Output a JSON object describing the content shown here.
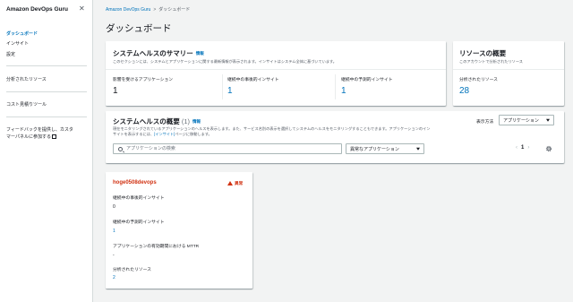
{
  "sidebar": {
    "title": "Amazon DevOps Guru",
    "close_glyph": "✕",
    "items": [
      {
        "label": "ダッシュボード",
        "active": true
      },
      {
        "label": "インサイト"
      },
      {
        "label": "設定"
      },
      {
        "label": "分析されたリソース"
      },
      {
        "label": "コスト見積りツール"
      }
    ],
    "feedback_line1": "フィードバックを提供し、カスタ",
    "feedback_line2": "マーパネルに参加する"
  },
  "breadcrumb": {
    "root": "Amazon DevOps Guru",
    "separator": ">",
    "current": "ダッシュボード"
  },
  "page": {
    "title": "ダッシュボード"
  },
  "system_health_summary": {
    "title": "システムヘルスのサマリー",
    "info": "情報",
    "description": "このセクションには、システムとアプリケーションに関する最新情報が表示されます。インサイトはシステム全体に基づいています。",
    "metrics": [
      {
        "label": "影響を受けるアプリケーション",
        "value": "1",
        "link": false
      },
      {
        "label": "継続中の事後的インサイト",
        "value": "1",
        "link": true
      },
      {
        "label": "継続中の予測的インサイト",
        "value": "1",
        "link": true
      }
    ]
  },
  "resource_overview": {
    "title": "リソースの概要",
    "description": "このアカウントで分析されたリソース",
    "label": "分析されたリソース",
    "value": "28"
  },
  "system_health_overview": {
    "title": "システムヘルスの概要",
    "count": "(1)",
    "info": "情報",
    "desc_line1": "現在モニタリングされているアプリケーションのヘルスを表示します。また、サービス名別の表示を選択してシステムのヘルスをモニタリングすることもできます。アプリケーションのイン",
    "desc_line2_a": "サイトを表示するには、",
    "desc_line2_link": "[インサイト]",
    "desc_line2_b": "ページに移動します。",
    "display_label": "表示方法",
    "display_select": "アプリケーション",
    "search_placeholder": "アプリケーションの検索",
    "filter_select": "異常なアプリケーション",
    "pager": {
      "prev": "‹",
      "page": "1",
      "next": "›"
    }
  },
  "app_card": {
    "name": "hoge0508devops",
    "status": "異常",
    "fields": [
      {
        "label": "継続中の事後的インサイト",
        "value": "0",
        "link": false
      },
      {
        "label": "継続中の予測的インサイト",
        "value": "1",
        "link": true
      },
      {
        "label": "アプリケーションの有効期間における MTTR",
        "value": "-",
        "link": false
      },
      {
        "label": "分析されたリソース",
        "value": "2",
        "link": true
      }
    ]
  },
  "colors": {
    "accent": "#0073bb",
    "alert": "#d13212",
    "background": "#f2f3f3"
  },
  "icons": [
    "close-icon",
    "external-link-icon",
    "search-icon",
    "caret-down-icon",
    "settings-gear-icon",
    "warning-icon"
  ]
}
